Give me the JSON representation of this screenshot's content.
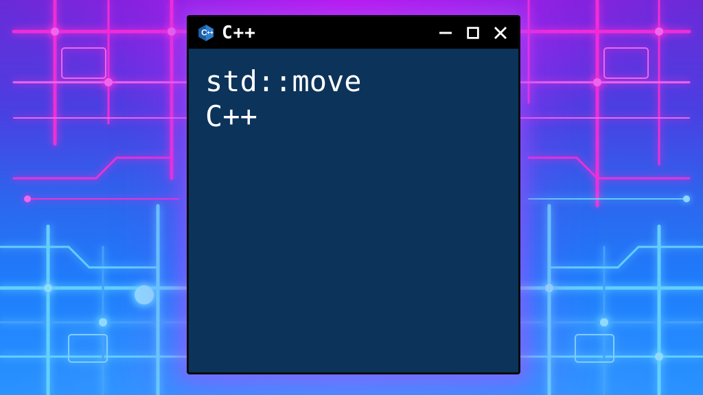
{
  "titlebar": {
    "title": "C++",
    "icon_name": "cpp-icon",
    "controls": {
      "minimize_label": "Minimize",
      "maximize_label": "Maximize",
      "close_label": "Close"
    }
  },
  "content": {
    "line1": "std::move",
    "line2": "C++"
  },
  "colors": {
    "titlebar_bg": "#000000",
    "window_bg": "#0c335a",
    "text": "#ffffff",
    "glow": "#b050ff"
  }
}
